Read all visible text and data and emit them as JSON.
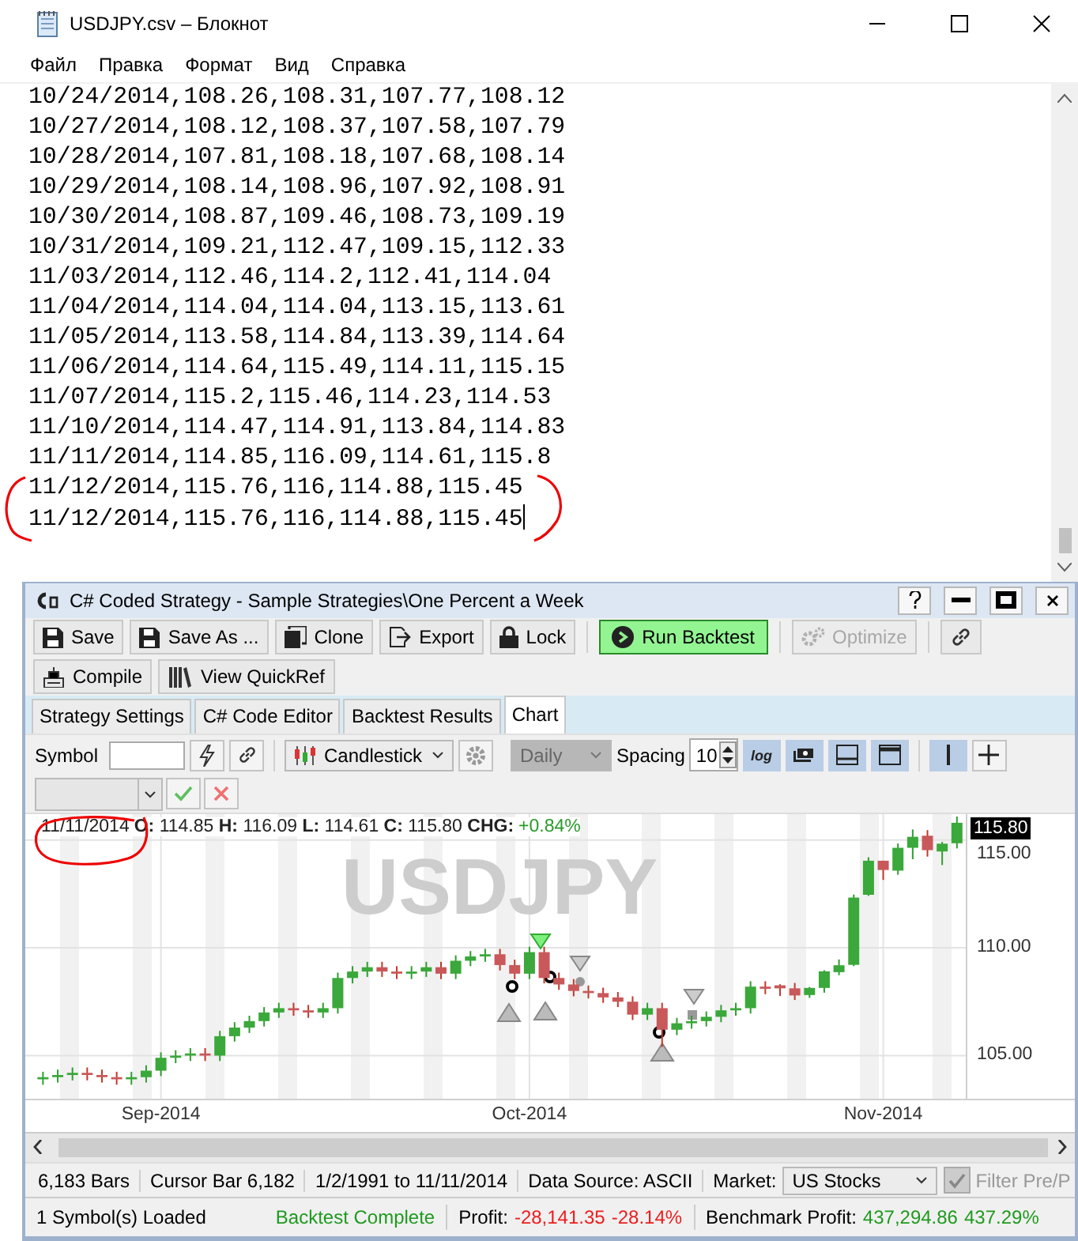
{
  "notepad": {
    "title": "USDJPY.csv – Блокнот",
    "menu": [
      "Файл",
      "Правка",
      "Формат",
      "Вид",
      "Справка"
    ],
    "lines": [
      "10/24/2014,108.26,108.31,107.77,108.12",
      "10/27/2014,108.12,108.37,107.58,107.79",
      "10/28/2014,107.81,108.18,107.68,108.14",
      "10/29/2014,108.14,108.96,107.92,108.91",
      "10/30/2014,108.87,109.46,108.73,109.19",
      "10/31/2014,109.21,112.47,109.15,112.33",
      "11/03/2014,112.46,114.2,112.41,114.04",
      "11/04/2014,114.04,114.04,113.15,113.61",
      "11/05/2014,113.58,114.84,113.39,114.64",
      "11/06/2014,114.64,115.49,114.11,115.15",
      "11/07/2014,115.2,115.46,114.23,114.53",
      "11/10/2014,114.47,114.91,113.84,114.83",
      "11/11/2014,114.85,116.09,114.61,115.8",
      "11/12/2014,115.76,116,114.88,115.45",
      "11/12/2014,115.76,116,114.88,115.45"
    ]
  },
  "strategy": {
    "title": "C# Coded Strategy - Sample Strategies\\One Percent a Week",
    "toolbar": [
      {
        "kind": "save",
        "label": "Save",
        "disabled": false
      },
      {
        "kind": "saveas",
        "label": "Save As ...",
        "disabled": false
      },
      {
        "kind": "clone",
        "label": "Clone",
        "disabled": false
      },
      {
        "kind": "export",
        "label": "Export",
        "disabled": false
      },
      {
        "kind": "lock",
        "label": "Lock",
        "disabled": false
      },
      {
        "kind": "run",
        "label": "Run Backtest",
        "disabled": false
      },
      {
        "kind": "optimize",
        "label": "Optimize",
        "disabled": true
      },
      {
        "kind": "link",
        "disabled": false
      }
    ],
    "toolbar2": [
      {
        "kind": "compile",
        "label": "Compile"
      },
      {
        "kind": "books",
        "label": "View QuickRef"
      }
    ],
    "tabs": [
      {
        "label": "Strategy Settings",
        "selected": false
      },
      {
        "label": "C# Code Editor",
        "selected": false
      },
      {
        "label": "Backtest Results",
        "selected": false
      },
      {
        "label": "Chart",
        "selected": true
      }
    ],
    "chart_toolbar": {
      "symbol_label": "Symbol",
      "chart_type": "Candlestick",
      "period": "Daily",
      "period_disabled": true,
      "spacing_label": "Spacing",
      "spacing": "10",
      "log": "log"
    },
    "chart": {
      "watermark": "USDJPY",
      "date": "11/11/2014",
      "ohlc": "**O:** 114.85 **H:** 116.09 **L:** 114.61 **C:** 115.80 **CHG:**",
      "change": "+0.84%",
      "price_tag": "115.80",
      "chart_data": {
        "type": "candlestick",
        "categories": [
          null,
          null,
          null,
          null,
          null,
          null,
          null,
          null,
          "Sep-2014",
          null,
          null,
          null,
          null,
          null,
          null,
          null,
          null,
          null,
          null,
          null,
          null,
          null,
          null,
          null,
          null,
          null,
          null,
          null,
          null,
          null,
          null,
          null,
          null,
          "Oct-2014",
          null,
          null,
          null,
          null,
          null,
          null,
          null,
          null,
          null,
          null,
          null,
          null,
          null,
          null,
          null,
          null,
          null,
          null,
          null,
          null,
          null,
          null,
          null,
          "Nov-2014",
          null,
          null,
          null,
          null,
          null
        ],
        "ohlc": [
          [
            103.9,
            104.25,
            103.65,
            104.0
          ],
          [
            104.0,
            104.35,
            103.75,
            104.1
          ],
          [
            104.1,
            104.45,
            103.85,
            104.2
          ],
          [
            104.2,
            104.45,
            103.85,
            104.1
          ],
          [
            104.1,
            104.35,
            103.75,
            104.0
          ],
          [
            104.0,
            104.25,
            103.65,
            103.9
          ],
          [
            103.9,
            104.25,
            103.65,
            104.0
          ],
          [
            104.0,
            104.55,
            103.75,
            104.3
          ],
          [
            104.3,
            105.15,
            104.05,
            104.9
          ],
          [
            104.9,
            105.25,
            104.65,
            105.0
          ],
          [
            105.0,
            105.35,
            104.75,
            105.1
          ],
          [
            105.1,
            105.35,
            104.75,
            105.0
          ],
          [
            105.0,
            106.15,
            104.75,
            105.9
          ],
          [
            105.9,
            106.55,
            105.65,
            106.3
          ],
          [
            106.3,
            106.85,
            106.05,
            106.6
          ],
          [
            106.6,
            107.25,
            106.35,
            107.0
          ],
          [
            107.0,
            107.45,
            106.75,
            107.2
          ],
          [
            107.2,
            107.45,
            106.85,
            107.1
          ],
          [
            107.1,
            107.35,
            106.75,
            107.0
          ],
          [
            107.0,
            107.45,
            106.75,
            107.2
          ],
          [
            107.2,
            108.85,
            106.95,
            108.6
          ],
          [
            108.6,
            109.15,
            108.35,
            108.9
          ],
          [
            108.9,
            109.35,
            108.65,
            109.1
          ],
          [
            109.1,
            109.35,
            108.65,
            108.9
          ],
          [
            108.9,
            109.15,
            108.55,
            108.8
          ],
          [
            108.8,
            109.15,
            108.55,
            108.9
          ],
          [
            108.9,
            109.35,
            108.65,
            109.1
          ],
          [
            109.1,
            109.35,
            108.55,
            108.8
          ],
          [
            108.8,
            109.65,
            108.55,
            109.4
          ],
          [
            109.4,
            109.85,
            109.15,
            109.6
          ],
          [
            109.6,
            109.95,
            109.35,
            109.7
          ],
          [
            109.7,
            109.95,
            108.95,
            109.2
          ],
          [
            109.2,
            109.45,
            108.55,
            108.8
          ],
          [
            108.8,
            110.05,
            108.55,
            109.8
          ],
          [
            109.8,
            110.05,
            108.35,
            108.6
          ],
          [
            108.6,
            108.85,
            108.05,
            108.3
          ],
          [
            108.3,
            108.55,
            107.75,
            108.0
          ],
          [
            108.0,
            108.25,
            107.65,
            107.9
          ],
          [
            107.9,
            108.15,
            107.45,
            107.7
          ],
          [
            107.7,
            107.95,
            107.25,
            107.5
          ],
          [
            107.5,
            107.75,
            106.65,
            106.9
          ],
          [
            106.9,
            107.45,
            106.65,
            107.2
          ],
          [
            107.2,
            107.45,
            105.4,
            106.2
          ],
          [
            106.2,
            106.75,
            105.95,
            106.5
          ],
          [
            106.5,
            106.85,
            106.25,
            106.6
          ],
          [
            106.6,
            107.05,
            106.35,
            106.8
          ],
          [
            106.8,
            107.35,
            106.55,
            107.1
          ],
          [
            107.1,
            107.45,
            106.85,
            107.2
          ],
          [
            107.2,
            108.45,
            106.95,
            108.2
          ],
          [
            108.2,
            108.45,
            107.85,
            108.1
          ],
          [
            108.26,
            108.31,
            107.77,
            108.12
          ],
          [
            108.12,
            108.37,
            107.58,
            107.79
          ],
          [
            107.81,
            108.18,
            107.68,
            108.14
          ],
          [
            108.14,
            108.96,
            107.92,
            108.91
          ],
          [
            108.87,
            109.46,
            108.73,
            109.19
          ],
          [
            109.21,
            112.47,
            109.15,
            112.33
          ],
          [
            112.46,
            114.2,
            112.41,
            114.04
          ],
          [
            114.04,
            114.04,
            113.15,
            113.61
          ],
          [
            113.58,
            114.84,
            113.39,
            114.64
          ],
          [
            114.64,
            115.49,
            114.11,
            115.15
          ],
          [
            115.2,
            115.46,
            114.23,
            114.53
          ],
          [
            114.47,
            114.91,
            113.84,
            114.83
          ],
          [
            114.85,
            116.09,
            114.61,
            115.8
          ]
        ],
        "ylim": [
          103,
          116.2
        ],
        "grid": true,
        "yticks": [
          {
            "value": 115,
            "label": "115.00"
          },
          {
            "value": 110,
            "label": "110.00"
          },
          {
            "value": 105,
            "label": "105.00"
          }
        ]
      }
    },
    "info_bar": [
      "6,183 Bars",
      "Cursor Bar 6,182",
      "1/2/1991 to 11/11/2014",
      "Data Source: ASCII"
    ],
    "market_label": "Market:",
    "market": "US Stocks",
    "filter": {
      "label": "Filter Pre/P",
      "checked": true,
      "disabled": true
    },
    "status": {
      "loaded": "1 Symbol(s) Loaded",
      "backtest": "Backtest Complete",
      "profit_label": "Profit:",
      "profit": "-28,141.35",
      "profit_pct": "-28.14%",
      "benchmark_label": "Benchmark Profit:",
      "benchmark": "437,294.86",
      "benchmark_pct": "437.29%"
    }
  }
}
